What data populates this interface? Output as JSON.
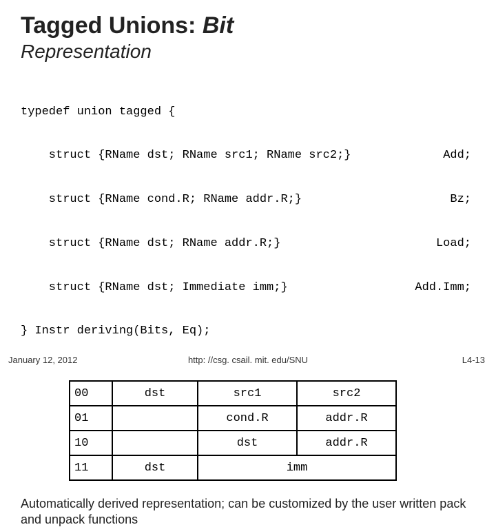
{
  "title_main": "Tagged Unions:",
  "title_tail": "Bit",
  "subtitle": "Representation",
  "code": {
    "l1": "typedef union tagged {",
    "r2l": "    struct {RName dst; RName src1; RName src2;}",
    "r2r": "Add;",
    "r3l": "    struct {RName cond.R; RName addr.R;}",
    "r3r": "Bz;",
    "r4l": "    struct {RName dst; RName addr.R;}",
    "r4r": "Load;",
    "r5l": "    struct {RName dst; Immediate imm;}",
    "r5r": "Add.Imm;",
    "l6": "} Instr deriving(Bits, Eq);"
  },
  "table": {
    "r0": {
      "tag": "00",
      "f1": "dst",
      "f2": "src1",
      "f3": "src2"
    },
    "r1": {
      "tag": "01",
      "f1": "",
      "f2": "cond.R",
      "f3": "addr.R"
    },
    "r2": {
      "tag": "10",
      "f1": "",
      "f2": "dst",
      "f3": "addr.R"
    },
    "r3": {
      "tag": "11",
      "f1": "dst",
      "imm": "imm"
    }
  },
  "caption": "Automatically derived representation; can be customized by the user written pack and unpack functions",
  "footer": {
    "date": "January 12, 2012",
    "url": "http: //csg. csail. mit. edu/SNU",
    "page": "L4-13"
  }
}
